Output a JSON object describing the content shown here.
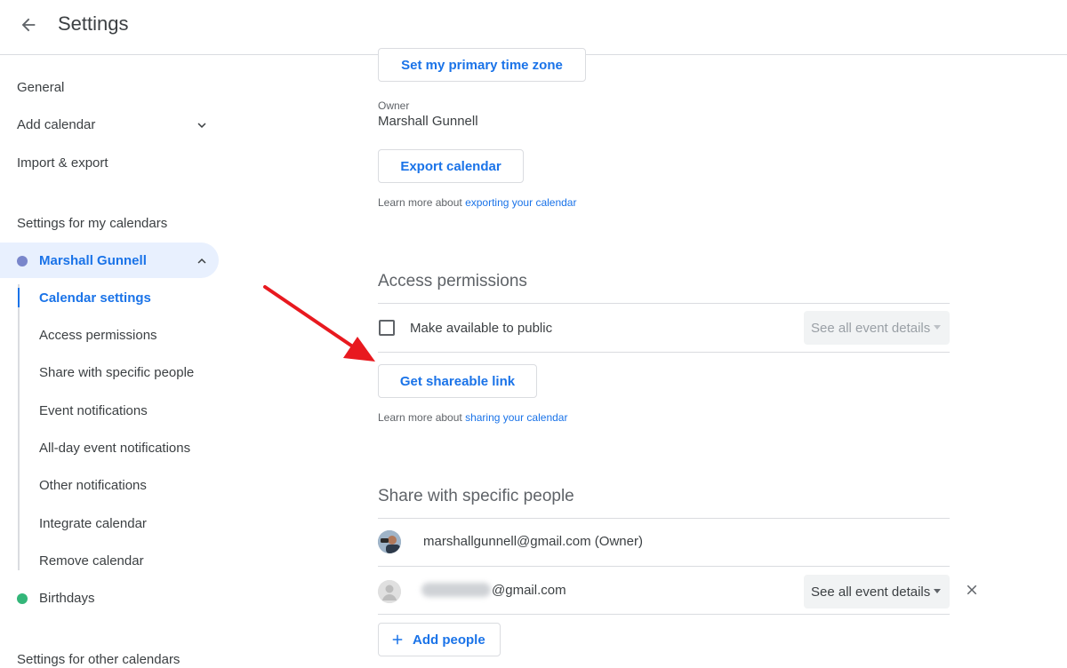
{
  "header": {
    "title": "Settings"
  },
  "sidebar": {
    "general": "General",
    "add_calendar": "Add calendar",
    "import_export": "Import & export",
    "section_my": "Settings for my calendars",
    "my_calendar": "Marshall Gunnell",
    "my_calendar_color": "#7986cb",
    "sub_items": [
      "Calendar settings",
      "Access permissions",
      "Share with specific people",
      "Event notifications",
      "All-day event notifications",
      "Other notifications",
      "Integrate calendar",
      "Remove calendar"
    ],
    "birthdays": "Birthdays",
    "birthdays_color": "#33b679",
    "section_other": "Settings for other calendars"
  },
  "main": {
    "time_zone_button": "Set my primary time zone",
    "owner_label": "Owner",
    "owner_value": "Marshall Gunnell",
    "export_button": "Export calendar",
    "export_help_prefix": "Learn more about ",
    "export_help_link": "exporting your calendar",
    "access_title": "Access permissions",
    "public_checkbox_label": "Make available to public",
    "public_select_value": "See all event details",
    "shareable_link_button": "Get shareable link",
    "share_help_prefix": "Learn more about ",
    "share_help_link": "sharing your calendar",
    "share_title": "Share with specific people",
    "people": [
      {
        "email": "marshallgunnell@gmail.com (Owner)"
      },
      {
        "email": "@gmail.com",
        "permission": "See all event details"
      }
    ],
    "add_people_button": "Add people"
  },
  "colors": {
    "accent": "#1a73e8",
    "annotation_arrow": "#e8191f"
  }
}
